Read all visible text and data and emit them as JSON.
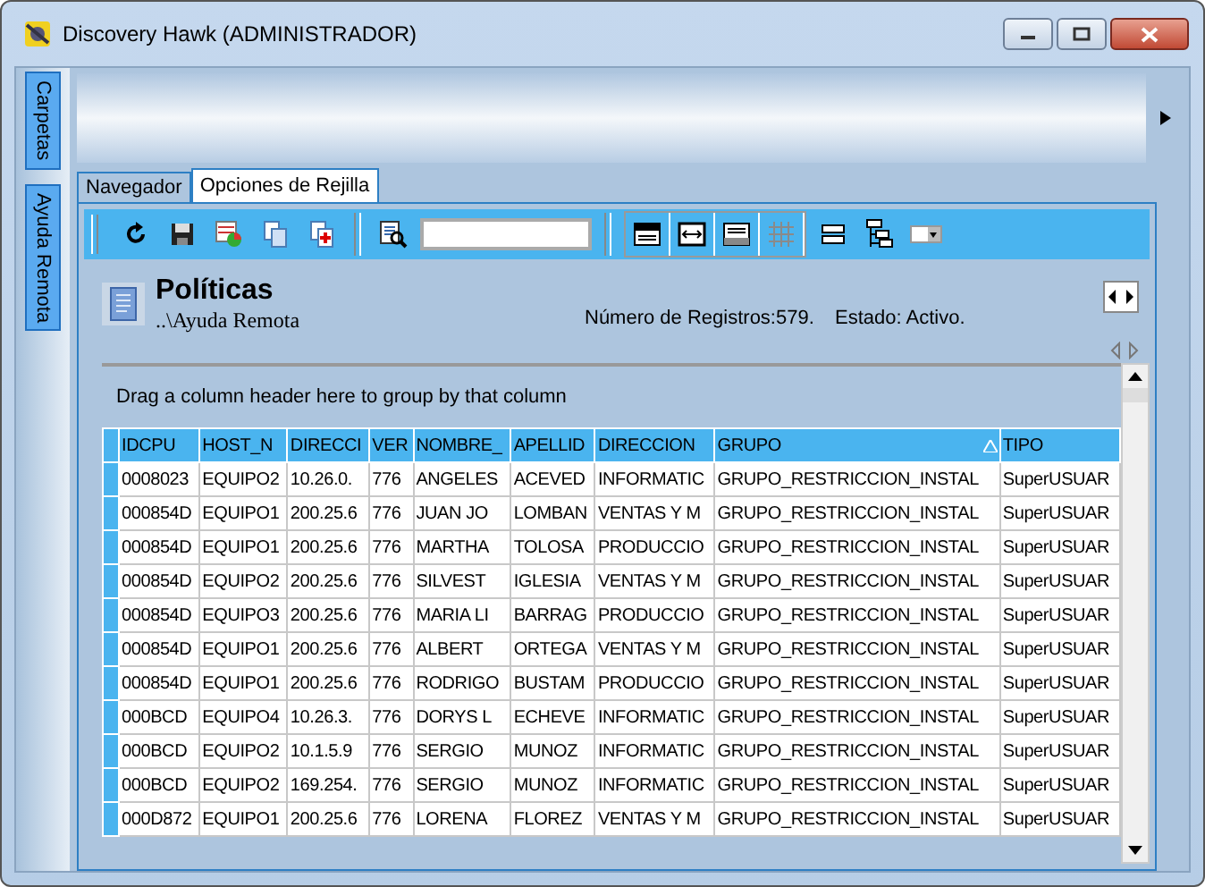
{
  "window": {
    "title": "Discovery Hawk (ADMINISTRADOR)"
  },
  "side_tabs": [
    {
      "label": "Carpetas"
    },
    {
      "label": "Ayuda Remota"
    }
  ],
  "tabs": [
    {
      "label": "Navegador",
      "selected": false
    },
    {
      "label": "Opciones de Rejilla",
      "selected": true
    }
  ],
  "toolbar": {
    "grid_lines": {
      "disabled": true
    }
  },
  "header": {
    "title": "Políticas",
    "path": "..\\Ayuda Remota",
    "records": "Número de Registros:579.",
    "status": "Estado: Activo."
  },
  "group_panel": {
    "hint": "Drag a column header here to group by that column"
  },
  "table": {
    "columns": [
      {
        "label": "IDCPU"
      },
      {
        "label": "HOST_N"
      },
      {
        "label": "DIRECCI"
      },
      {
        "label": "VER"
      },
      {
        "label": "NOMBRE_"
      },
      {
        "label": "APELLID"
      },
      {
        "label": "DIRECCION"
      },
      {
        "label": "GRUPO",
        "sorted": true
      },
      {
        "label": "TIPO"
      }
    ],
    "rows": [
      [
        "0008023",
        "EQUIPO2",
        "10.26.0.",
        "776",
        "ANGELES",
        "ACEVED",
        "INFORMATIC",
        "GRUPO_RESTRICCION_INSTAL",
        "SuperUSUAR"
      ],
      [
        "000854D",
        "EQUIPO1",
        "200.25.6",
        "776",
        "JUAN JO",
        "LOMBAN",
        "VENTAS Y M",
        "GRUPO_RESTRICCION_INSTAL",
        "SuperUSUAR"
      ],
      [
        "000854D",
        "EQUIPO1",
        "200.25.6",
        "776",
        "MARTHA",
        "TOLOSA",
        "PRODUCCIO",
        "GRUPO_RESTRICCION_INSTAL",
        "SuperUSUAR"
      ],
      [
        "000854D",
        "EQUIPO2",
        "200.25.6",
        "776",
        "SILVEST",
        "IGLESIA",
        "VENTAS Y M",
        "GRUPO_RESTRICCION_INSTAL",
        "SuperUSUAR"
      ],
      [
        "000854D",
        "EQUIPO3",
        "200.25.6",
        "776",
        "MARIA LI",
        "BARRAG",
        "PRODUCCIO",
        "GRUPO_RESTRICCION_INSTAL",
        "SuperUSUAR"
      ],
      [
        "000854D",
        "EQUIPO1",
        "200.25.6",
        "776",
        "ALBERT",
        "ORTEGA",
        "VENTAS Y M",
        "GRUPO_RESTRICCION_INSTAL",
        "SuperUSUAR"
      ],
      [
        "000854D",
        "EQUIPO1",
        "200.25.6",
        "776",
        "RODRIGO",
        "BUSTAM",
        "PRODUCCIO",
        "GRUPO_RESTRICCION_INSTAL",
        "SuperUSUAR"
      ],
      [
        "000BCD",
        "EQUIPO4",
        "10.26.3.",
        "776",
        "DORYS L",
        "ECHEVE",
        "INFORMATIC",
        "GRUPO_RESTRICCION_INSTAL",
        "SuperUSUAR"
      ],
      [
        "000BCD",
        "EQUIPO2",
        "10.1.5.9",
        "776",
        "SERGIO",
        "MUNOZ",
        "INFORMATIC",
        "GRUPO_RESTRICCION_INSTAL",
        "SuperUSUAR"
      ],
      [
        "000BCD",
        "EQUIPO2",
        "169.254.",
        "776",
        "SERGIO",
        "MUNOZ",
        "INFORMATIC",
        "GRUPO_RESTRICCION_INSTAL",
        "SuperUSUAR"
      ],
      [
        "000D872",
        "EQUIPO1",
        "200.25.6",
        "776",
        "LORENA",
        "FLOREZ",
        "VENTAS Y M",
        "GRUPO_RESTRICCION_INSTAL",
        "SuperUSUAR"
      ]
    ]
  }
}
